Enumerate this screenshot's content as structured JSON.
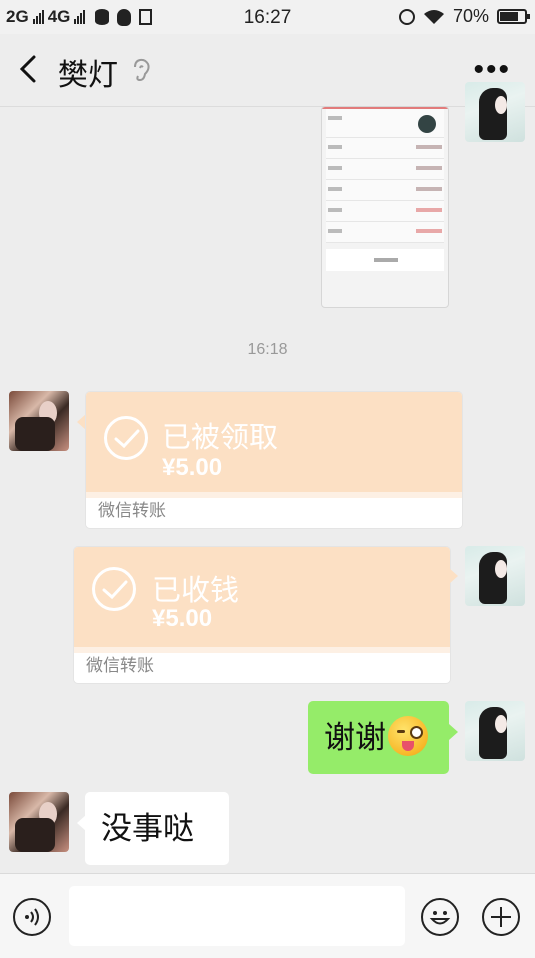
{
  "status_bar": {
    "network1": "2G",
    "network2": "4G",
    "time": "16:27",
    "battery": "70%"
  },
  "header": {
    "title": "樊灯",
    "back_icon": "chevron-left-icon",
    "more_label": "•••"
  },
  "messages": {
    "timestamp": "16:18",
    "transfer_received": {
      "status": "已被领取",
      "amount": "¥5.00",
      "footer": "微信转账"
    },
    "transfer_collected": {
      "status": "已收钱",
      "amount": "¥5.00",
      "footer": "微信转账"
    },
    "thanks": {
      "text": "谢谢",
      "emoji": "winking-tongue-emoji"
    },
    "reply": {
      "text": "没事哒"
    }
  },
  "input_bar": {
    "voice_icon": "voice-icon",
    "emoji_icon": "emoji-icon",
    "plus_icon": "plus-icon",
    "value": ""
  },
  "colors": {
    "transfer_bg": "#fce0c4",
    "my_bubble": "#95ec69",
    "chat_bg": "#ededed"
  }
}
